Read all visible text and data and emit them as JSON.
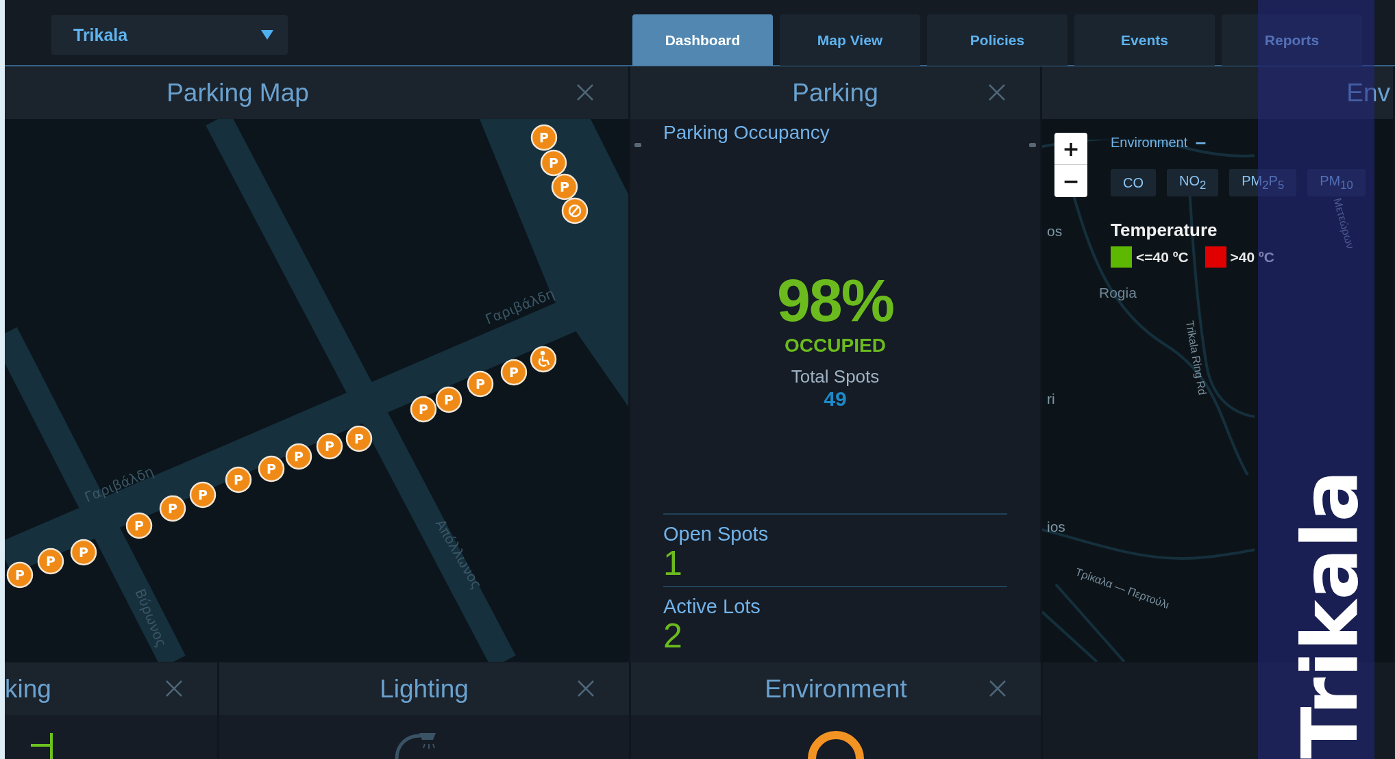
{
  "city_selector": {
    "value": "Trikala"
  },
  "tabs": [
    {
      "label": "Dashboard",
      "selected": true
    },
    {
      "label": "Map View",
      "selected": false
    },
    {
      "label": "Policies",
      "selected": false
    },
    {
      "label": "Events",
      "selected": false
    },
    {
      "label": "Reports",
      "selected": false
    }
  ],
  "parking_map": {
    "title": "Parking Map",
    "street_labels": [
      "Γαριβάλδη",
      "Γαριβάλδη",
      "Βύρωνος",
      "Απόλλωνος"
    ],
    "markers": [
      {
        "kind": "parking",
        "label": "P"
      },
      {
        "kind": "parking",
        "label": "P"
      },
      {
        "kind": "parking",
        "label": "P"
      },
      {
        "kind": "no-entry"
      },
      {
        "kind": "parking",
        "label": "P"
      },
      {
        "kind": "parking",
        "label": "P"
      },
      {
        "kind": "parking",
        "label": "P"
      },
      {
        "kind": "parking",
        "label": "P"
      },
      {
        "kind": "accessible"
      },
      {
        "kind": "parking",
        "label": "P"
      },
      {
        "kind": "parking",
        "label": "P"
      },
      {
        "kind": "parking",
        "label": "P"
      },
      {
        "kind": "parking",
        "label": "P"
      },
      {
        "kind": "parking",
        "label": "P"
      },
      {
        "kind": "parking",
        "label": "P"
      },
      {
        "kind": "parking",
        "label": "P"
      },
      {
        "kind": "parking",
        "label": "P"
      },
      {
        "kind": "parking",
        "label": "P"
      },
      {
        "kind": "parking",
        "label": "P"
      },
      {
        "kind": "parking",
        "label": "P"
      }
    ]
  },
  "parking": {
    "title": "Parking",
    "subtitle": "Parking Occupancy",
    "percent": "98%",
    "status": "OCCUPIED",
    "total_label": "Total Spots",
    "total": "49",
    "stats": [
      {
        "label": "Open Spots",
        "value": "1"
      },
      {
        "label": "Active Lots",
        "value": "2"
      }
    ]
  },
  "environment_map": {
    "title": "Env",
    "zoom_in": "+",
    "zoom_out": "−",
    "layer_label": "Environment",
    "collapse": "−",
    "pollutants": [
      "CO",
      "NO$_{2}$",
      "PM$_{2}$P$_{5}$",
      "PM$_{10}$"
    ],
    "legend_title": "Temperature",
    "legend": [
      {
        "label": "<=40 ºC",
        "color": "#5cb800"
      },
      {
        "label": ">40 ºC",
        "color": "#e00000"
      }
    ],
    "map_labels": [
      "os",
      "Rogia",
      "ri",
      "ios",
      "Trikala Ring Rd",
      "Τρίκαλα — Περτούλι",
      "Μετεώρων"
    ]
  },
  "bottom_panels": [
    {
      "title": "king",
      "kind": "parking"
    },
    {
      "title": "Lighting",
      "kind": "lighting"
    },
    {
      "title": "Environment",
      "kind": "environment"
    }
  ],
  "banner": {
    "text": "Trikala"
  }
}
